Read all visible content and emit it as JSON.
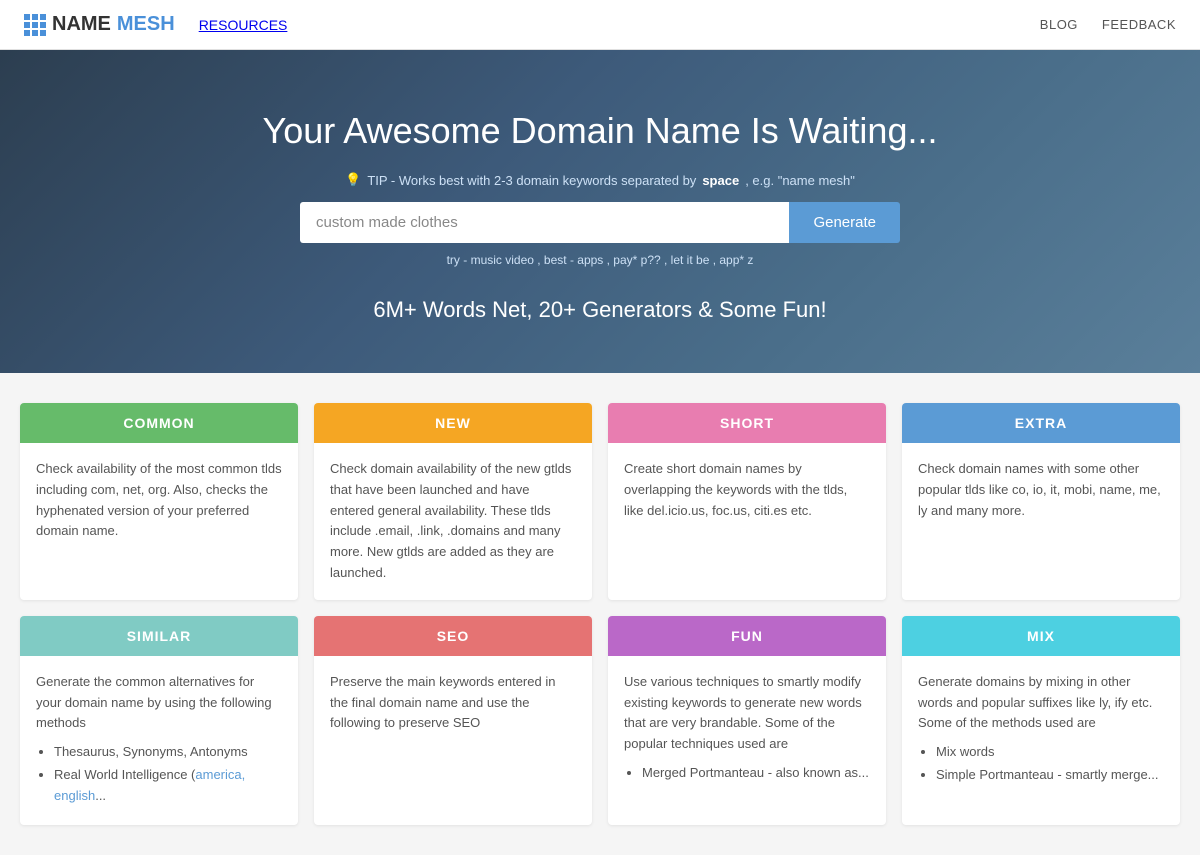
{
  "header": {
    "logo_name": "NAME",
    "logo_suffix": "MESH",
    "nav": [
      {
        "label": "RESOURCES",
        "href": "#"
      }
    ],
    "right_links": [
      {
        "label": "BLOG",
        "href": "#"
      },
      {
        "label": "FEEDBACK",
        "href": "#"
      }
    ]
  },
  "hero": {
    "title": "Your Awesome Domain Name Is Waiting...",
    "tip_prefix": "TIP - Works best with 2-3 domain keywords separated by",
    "tip_keyword": "space",
    "tip_suffix": ", e.g. \"name mesh\"",
    "search_placeholder": "custom made clothes",
    "search_value": "custom made clothes",
    "generate_button": "Generate",
    "try_text": "try - music video , best - apps , pay* p?? , let it be , app* z",
    "tagline": "6M+ Words Net, 20+ Generators & Some Fun!"
  },
  "cards": [
    {
      "id": "common",
      "header": "COMMON",
      "color": "bg-green",
      "body": "Check availability of the most common tlds including com, net, org. Also, checks the hyphenated version of your preferred domain name."
    },
    {
      "id": "new",
      "header": "NEW",
      "color": "bg-yellow",
      "body": "Check domain availability of the new gtlds that have been launched and have entered general availability. These tlds include .email, .link, .domains and many more. New gtlds are added as they are launched."
    },
    {
      "id": "short",
      "header": "SHORT",
      "color": "bg-pink",
      "body": "Create short domain names by overlapping the keywords with the tlds, like del.icio.us, foc.us, citi.es etc."
    },
    {
      "id": "extra",
      "header": "EXTRA",
      "color": "bg-blue",
      "body": "Check domain names with some other popular tlds like co, io, it, mobi, name, me, ly and many more."
    },
    {
      "id": "similar",
      "header": "SIMILAR",
      "color": "bg-teal",
      "body": "Generate the common alternatives for your domain name by using the following methods",
      "list": [
        "Thesaurus, Synonyms, Antonyms",
        "Real World Intelligence (america, english..."
      ]
    },
    {
      "id": "seo",
      "header": "SEO",
      "color": "bg-red",
      "body": "Preserve the main keywords entered in the final domain name and use the following to preserve SEO"
    },
    {
      "id": "fun",
      "header": "FUN",
      "color": "bg-purple",
      "body": "Use various techniques to smartly modify existing keywords to generate new words that are very brandable. Some of the popular techniques used are",
      "list": [
        "Merged Portmanteau - also known as..."
      ]
    },
    {
      "id": "mix",
      "header": "MIX",
      "color": "bg-cyan",
      "body": "Generate domains by mixing in other words and popular suffixes like ly, ify etc. Some of the methods used are",
      "list": [
        "Mix words",
        "Simple Portmanteau - smartly merge..."
      ]
    }
  ]
}
